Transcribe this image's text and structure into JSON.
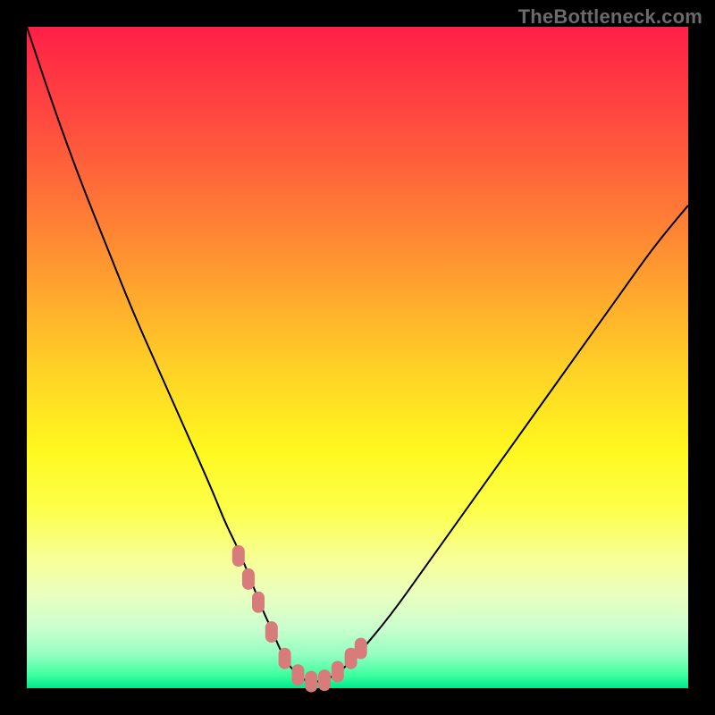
{
  "watermark": "TheBottleneck.com",
  "colors": {
    "frame": "#000000",
    "gradient_top": "#ff1f47",
    "gradient_bottom": "#00e88a",
    "curve": "#000000",
    "marker": "#d77b7b"
  },
  "chart_data": {
    "type": "line",
    "title": "",
    "xlabel": "",
    "ylabel": "",
    "xlim": [
      0,
      100
    ],
    "ylim": [
      0,
      100
    ],
    "x": [
      0,
      4,
      8,
      12,
      16,
      20,
      24,
      28,
      30,
      32,
      34,
      36,
      37,
      38,
      39,
      40,
      41,
      42,
      43,
      44,
      45,
      47,
      50,
      55,
      60,
      65,
      70,
      75,
      80,
      85,
      90,
      95,
      100
    ],
    "values": [
      100,
      88,
      77,
      67,
      57,
      48,
      39,
      30,
      25,
      21,
      16,
      11,
      9,
      6.5,
      4.5,
      3,
      2,
      1.2,
      1,
      1,
      1.2,
      2.2,
      5,
      11,
      18,
      25,
      32,
      39,
      46,
      53,
      60,
      67,
      73
    ],
    "markers": {
      "x": [
        32,
        33.5,
        35,
        37,
        39,
        41,
        43,
        45,
        47,
        49,
        50.5
      ],
      "y": [
        20,
        16.5,
        13,
        8.5,
        4.5,
        2,
        1,
        1.2,
        2.5,
        4.5,
        6
      ]
    },
    "annotations": []
  }
}
